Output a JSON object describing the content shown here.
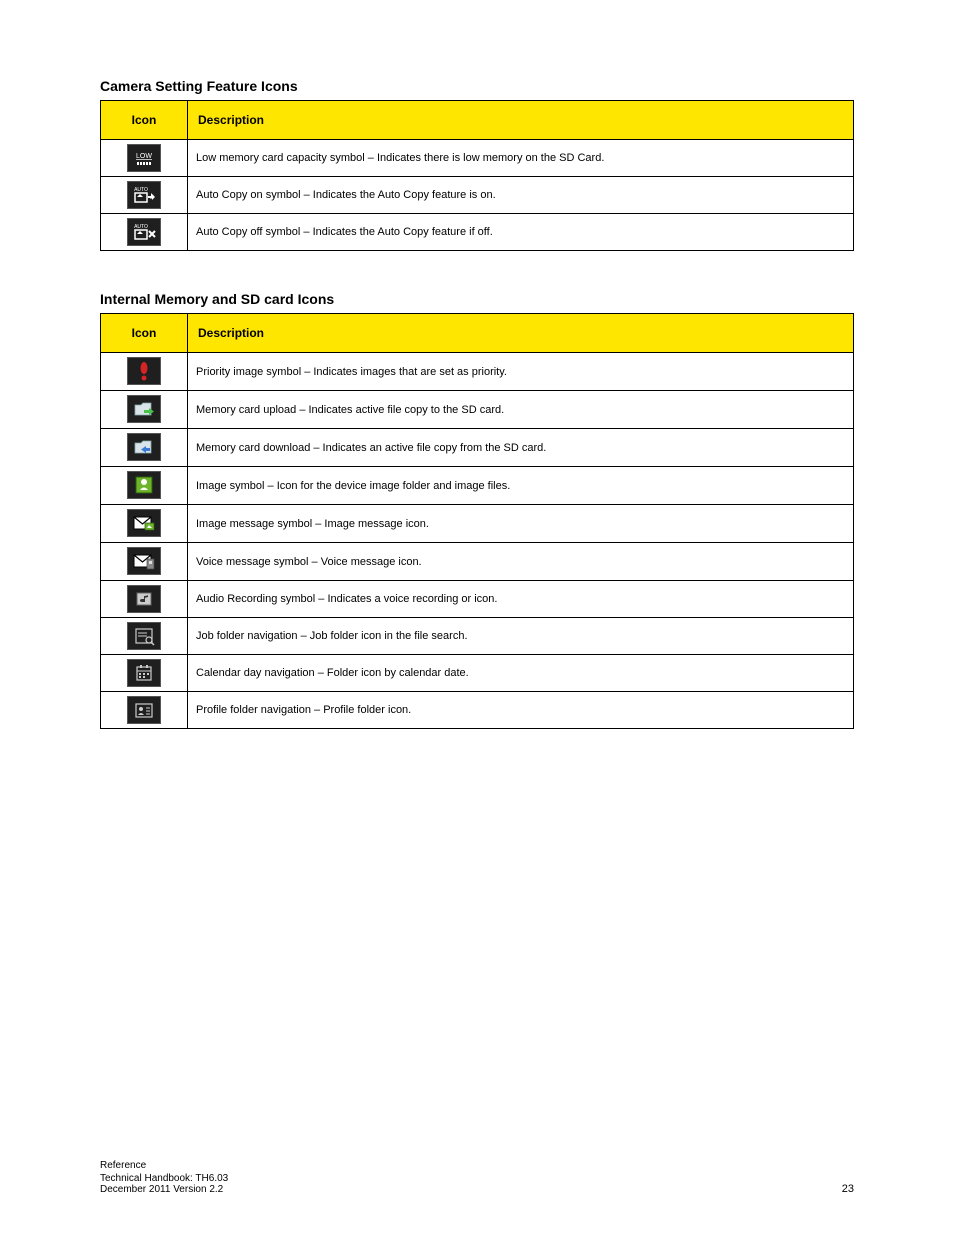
{
  "section1": {
    "title": "Camera Setting Feature Icons",
    "header_icon": "Icon",
    "header_desc": "Description",
    "rows": [
      {
        "desc": "Low memory card capacity symbol – Indicates there is low memory on the SD Card."
      },
      {
        "desc": "Auto Copy on symbol – Indicates the Auto Copy feature is on."
      },
      {
        "desc": "Auto Copy off symbol – Indicates the Auto Copy feature if off."
      }
    ]
  },
  "section2": {
    "title": "Internal Memory and SD card Icons",
    "header_icon": "Icon",
    "header_desc": "Description",
    "rows": [
      {
        "desc": "Priority image symbol – Indicates images that are set as priority."
      },
      {
        "desc": "Memory card upload – Indicates active file copy to the SD card."
      },
      {
        "desc": "Memory card download – Indicates an active file copy from the SD card."
      },
      {
        "desc": "Image symbol – Icon for the device image folder and image files."
      },
      {
        "desc": "Image message symbol – Image message icon."
      },
      {
        "desc": "Voice message symbol – Voice message icon."
      },
      {
        "desc": "Audio Recording symbol – Indicates a voice recording or icon."
      },
      {
        "desc": "Job folder navigation – Job folder icon in the file search."
      },
      {
        "desc": "Calendar day navigation – Folder icon by calendar date."
      },
      {
        "desc": "Profile folder navigation – Profile folder icon."
      }
    ]
  },
  "footer": {
    "title": "Reference",
    "line1": "Technical Handbook: TH6.03",
    "line2": "December 2011  Version 2.2",
    "page": "23"
  }
}
